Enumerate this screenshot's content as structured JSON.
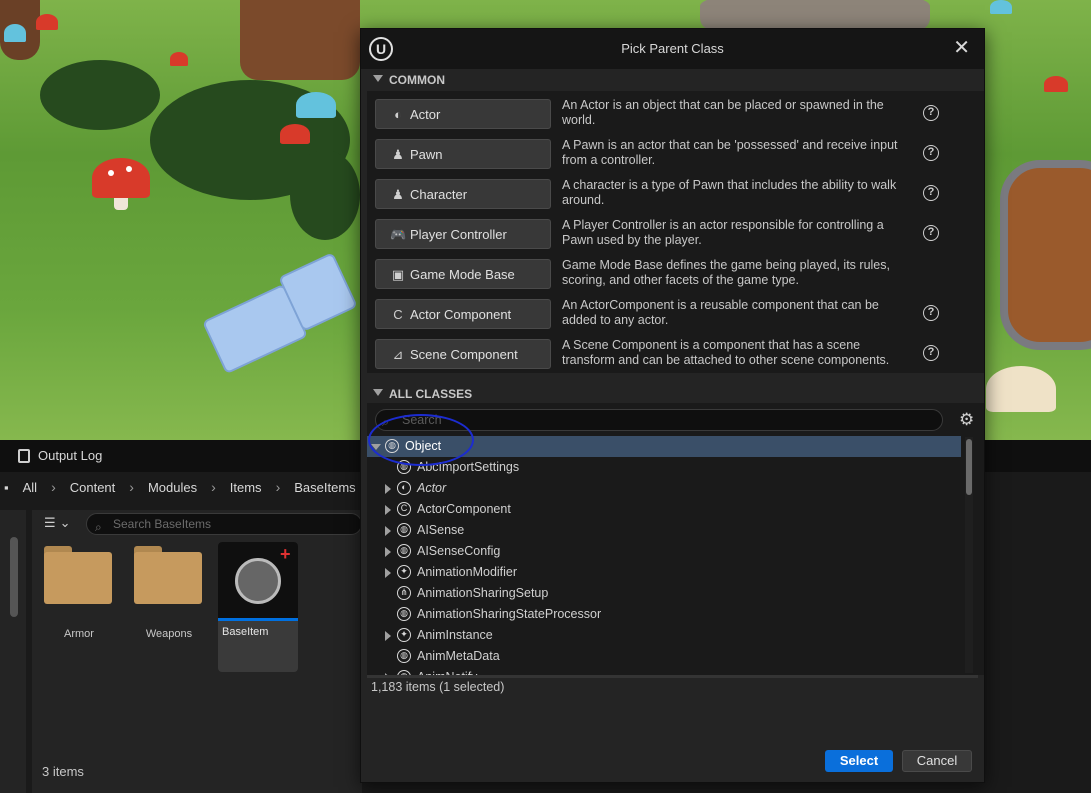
{
  "content_browser": {
    "tab_label": "Output Log",
    "breadcrumb": [
      "All",
      "Content",
      "Modules",
      "Items",
      "BaseItems"
    ],
    "search_placeholder": "Search BaseItems",
    "tiles": [
      {
        "label": "Armor"
      },
      {
        "label": "Weapons"
      },
      {
        "label": "BaseItem"
      }
    ],
    "status": "3 items"
  },
  "dialog": {
    "title": "Pick Parent Class",
    "logo_text": "U",
    "close_glyph": "✕",
    "common_header": "COMMON",
    "common_classes": [
      {
        "label": "Actor",
        "icon": "actor-icon",
        "glyph": "◐",
        "desc": "An Actor is an object that can be placed or spawned in the world.",
        "help": true
      },
      {
        "label": "Pawn",
        "icon": "pawn-icon",
        "glyph": "♟",
        "desc": "A Pawn is an actor that can be 'possessed' and receive input from a controller.",
        "help": true
      },
      {
        "label": "Character",
        "icon": "character-icon",
        "glyph": "♟",
        "desc": "A character is a type of Pawn that includes the ability to walk around.",
        "help": true
      },
      {
        "label": "Player Controller",
        "icon": "gamepad-icon",
        "glyph": "🎮",
        "desc": "A Player Controller is an actor responsible for controlling a Pawn used by the player.",
        "help": true
      },
      {
        "label": "Game Mode Base",
        "icon": "game-mode-icon",
        "glyph": "▣",
        "desc": "Game Mode Base defines the game being played, its rules, scoring, and other facets of the game type.",
        "help": false
      },
      {
        "label": "Actor Component",
        "icon": "actor-component-icon",
        "glyph": "C",
        "desc": "An ActorComponent is a reusable component that can be added to any actor.",
        "help": true
      },
      {
        "label": "Scene Component",
        "icon": "scene-component-icon",
        "glyph": "⊿",
        "desc": "A Scene Component is a component that has a scene transform and can be attached to other scene components.",
        "help": true
      }
    ],
    "all_header": "ALL CLASSES",
    "search_placeholder": "Search",
    "help_glyph": "?",
    "gear_glyph": "⚙",
    "tree": [
      {
        "label": "Object",
        "depth": 0,
        "expand": "down",
        "selected": true,
        "icon": "object-icon",
        "glyph": "◍"
      },
      {
        "label": "AbcImportSettings",
        "depth": 1,
        "expand": "none",
        "icon": "object-icon",
        "glyph": "◍"
      },
      {
        "label": "Actor",
        "depth": 1,
        "expand": "right",
        "italic": true,
        "icon": "actor-icon",
        "glyph": "◐"
      },
      {
        "label": "ActorComponent",
        "depth": 1,
        "expand": "right",
        "icon": "component-icon",
        "glyph": "C"
      },
      {
        "label": "AISense",
        "depth": 1,
        "expand": "right",
        "icon": "object-icon",
        "glyph": "◍"
      },
      {
        "label": "AISenseConfig",
        "depth": 1,
        "expand": "right",
        "icon": "object-icon",
        "glyph": "◍"
      },
      {
        "label": "AnimationModifier",
        "depth": 1,
        "expand": "right",
        "icon": "animation-icon",
        "glyph": "✦"
      },
      {
        "label": "AnimationSharingSetup",
        "depth": 1,
        "expand": "none",
        "icon": "sharing-icon",
        "glyph": "⋔"
      },
      {
        "label": "AnimationSharingStateProcessor",
        "depth": 1,
        "expand": "none",
        "icon": "object-icon",
        "glyph": "◍"
      },
      {
        "label": "AnimInstance",
        "depth": 1,
        "expand": "right",
        "icon": "animation-icon",
        "glyph": "✦"
      },
      {
        "label": "AnimMetaData",
        "depth": 1,
        "expand": "none",
        "icon": "object-icon",
        "glyph": "◍"
      },
      {
        "label": "AnimNotify",
        "depth": 1,
        "expand": "right",
        "icon": "object-icon",
        "glyph": "◍"
      }
    ],
    "items_count": "1,183 items (1 selected)",
    "select_label": "Select",
    "cancel_label": "Cancel",
    "colors": {
      "select": "#0a6fdb",
      "selected_row": "#3a4f68",
      "annotation": "#1c2cd0"
    }
  }
}
